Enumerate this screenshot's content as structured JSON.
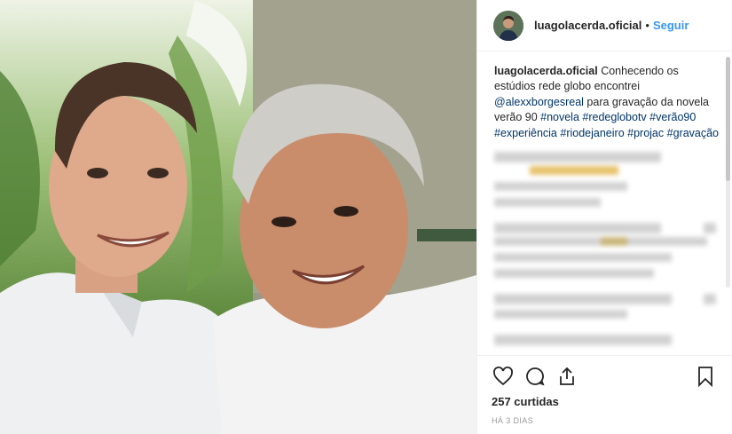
{
  "photo": {
    "alt": ""
  },
  "header": {
    "username": "luagolacerda.oficial",
    "separator": "•",
    "follow_label": "Seguir"
  },
  "caption": {
    "username": "luagolacerda.oficial",
    "text_1": " Conhecendo os estúdios rede globo encontrei ",
    "mention": "@alexxborgesreal",
    "text_2": " para gravação da novela verão 90 ",
    "hashtags": [
      "#novela",
      "#redeglobotv",
      "#verão90",
      "#experiência",
      "#riodejaneiro",
      "#projac",
      "#gravação"
    ]
  },
  "actions": {
    "like_icon": "heart-icon",
    "comment_icon": "comment-icon",
    "share_icon": "share-icon",
    "save_icon": "bookmark-icon",
    "likes": "257 curtidas",
    "time": "HÁ 3 DIAS"
  },
  "colors": {
    "link": "#003569",
    "follow": "#3897f0",
    "text": "#262626",
    "muted": "#999999",
    "border": "#efefef"
  }
}
